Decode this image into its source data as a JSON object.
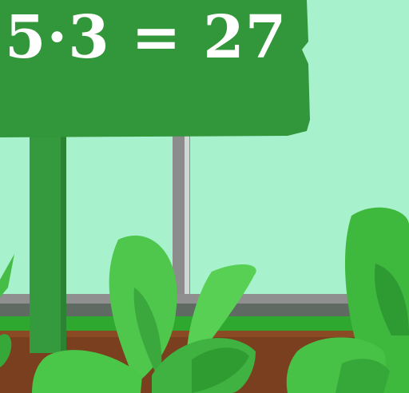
{
  "equation": "5·3 = 27",
  "colors": {
    "sky": "#a7f1cd",
    "sign_green": "#32963a",
    "sign_post": "#35993d",
    "window_frame": "#8c8c8c",
    "grass_strip": "#2ea82e",
    "soil": "#7a3f1e",
    "leaf_light": "#57d053",
    "leaf_dark": "#2f9c32",
    "text": "#ffffff"
  },
  "icons": [
    "equation-sign",
    "sign-post",
    "window-frame",
    "garden-bed",
    "plant-left",
    "plant-center",
    "plant-right"
  ]
}
